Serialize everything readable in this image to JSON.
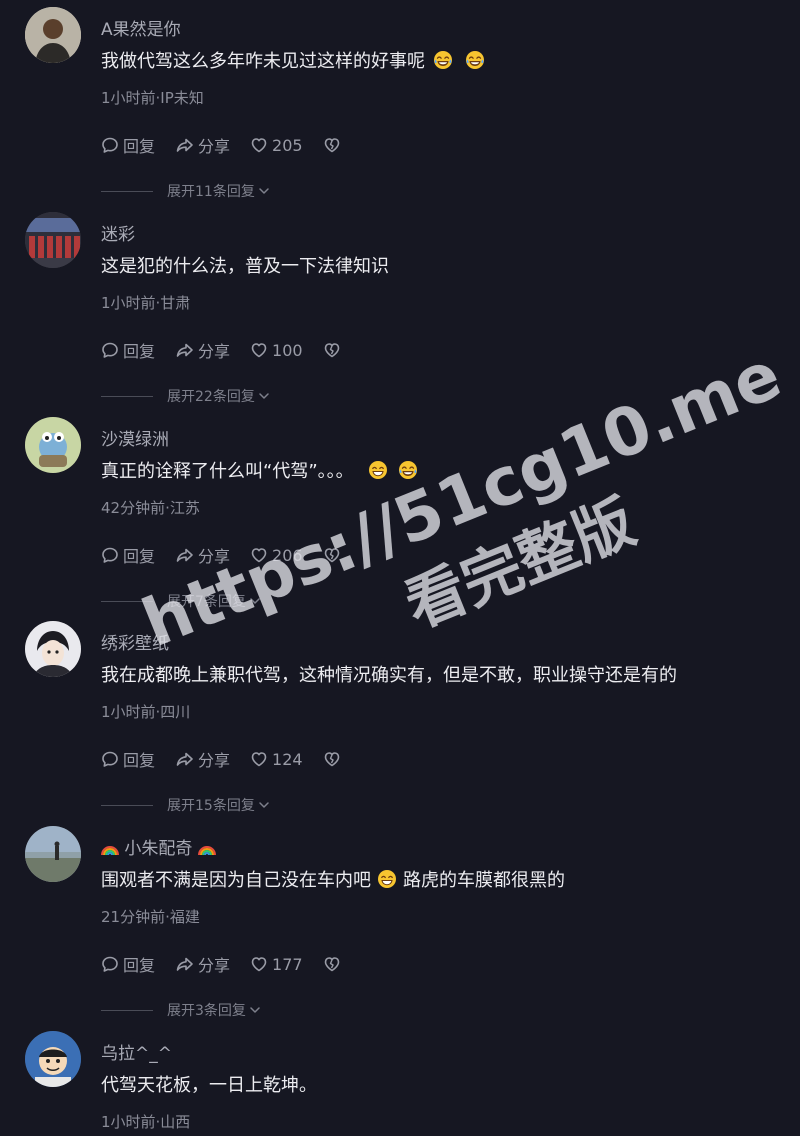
{
  "comments": [
    {
      "username": "A果然是你",
      "content": "我做代驾这么多年咋未见过这样的好事呢",
      "emoji_count": 2,
      "meta": "1小时前·IP未知",
      "reply_label": "回复",
      "share_label": "分享",
      "likes": "205",
      "expand_label": "展开11条回复"
    },
    {
      "username": "迷彩",
      "content": "这是犯的什么法，普及一下法律知识",
      "emoji_count": 0,
      "meta": "1小时前·甘肃",
      "reply_label": "回复",
      "share_label": "分享",
      "likes": "100",
      "expand_label": "展开22条回复"
    },
    {
      "username": "沙漠绿洲",
      "content": "真正的诠释了什么叫“代驾”。。。",
      "emoji_count": 2,
      "meta": "42分钟前·江苏",
      "reply_label": "回复",
      "share_label": "分享",
      "likes": "206",
      "expand_label": "展开7条回复"
    },
    {
      "username": "绣彩壁纸",
      "content": "我在成都晚上兼职代驾，这种情况确实有，但是不敢，职业操守还是有的",
      "emoji_count": 0,
      "meta": "1小时前·四川",
      "reply_label": "回复",
      "share_label": "分享",
      "likes": "124",
      "expand_label": "展开15条回复"
    },
    {
      "username": "小朱配奇",
      "content_part1": "围观者不满是因为自己没在车内吧",
      "content_part2": "路虎的车膜都很黑的",
      "meta": "21分钟前·福建",
      "reply_label": "回复",
      "share_label": "分享",
      "likes": "177",
      "expand_label": "展开3条回复"
    },
    {
      "username": "乌拉^_^",
      "content": "代驾天花板，一日上乾坤。",
      "meta": "1小时前·山西"
    }
  ],
  "watermark": {
    "line1": "https://51cg10.me",
    "line2": "看完整版"
  }
}
